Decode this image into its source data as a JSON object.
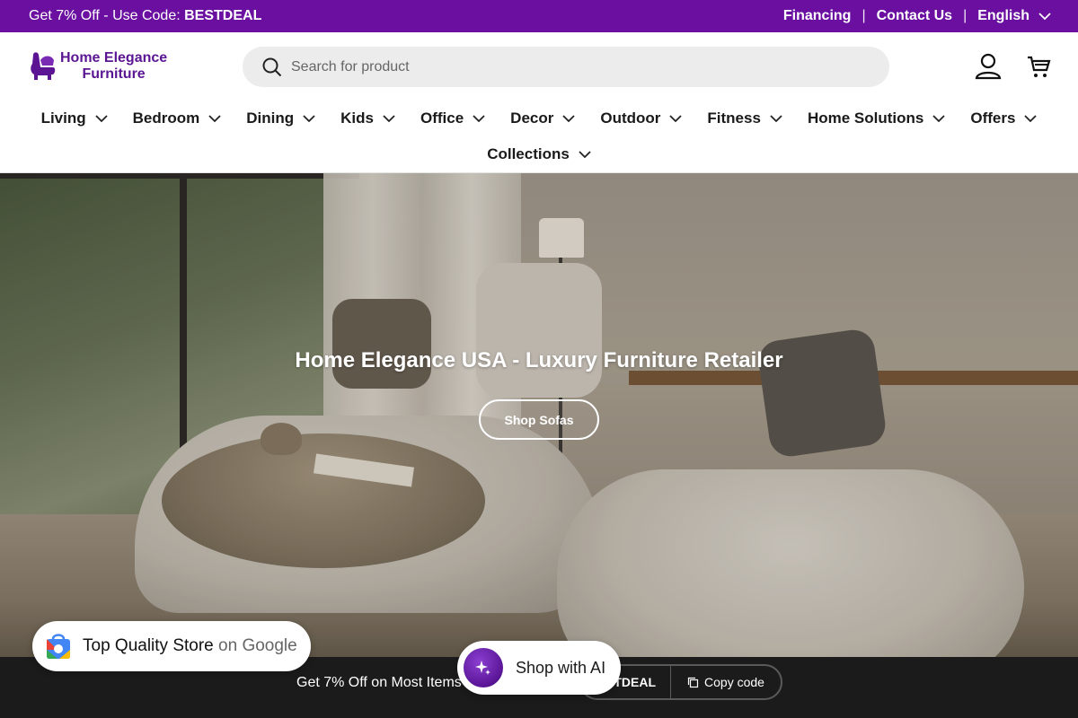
{
  "announcement": {
    "promo_prefix": "Get 7% Off - Use Code: ",
    "promo_code": "BESTDEAL",
    "links": [
      "Financing",
      "Contact Us"
    ],
    "language": "English"
  },
  "brand": {
    "line1": "Home Elegance",
    "line2": "Furniture",
    "color": "#5b1593"
  },
  "search": {
    "placeholder": "Search for product"
  },
  "nav": {
    "row1": [
      "Living",
      "Bedroom",
      "Dining",
      "Kids",
      "Office",
      "Decor",
      "Outdoor",
      "Fitness",
      "Home Solutions",
      "Offers"
    ],
    "row2": [
      "Collections"
    ]
  },
  "hero": {
    "title": "Home Elegance USA - Luxury Furniture Retailer",
    "button": "Shop Sofas"
  },
  "promo_bar": {
    "text": "Get 7% Off on Most Items",
    "code": "BESTDEAL",
    "copy_label": "Copy code"
  },
  "google_badge": {
    "text": "Top Quality Store",
    "suffix": "on Google"
  },
  "shop_ai": {
    "label": "Shop with AI"
  },
  "colors": {
    "accent": "#6a0fa0",
    "promo_bar_bg": "#1b1b1b"
  }
}
